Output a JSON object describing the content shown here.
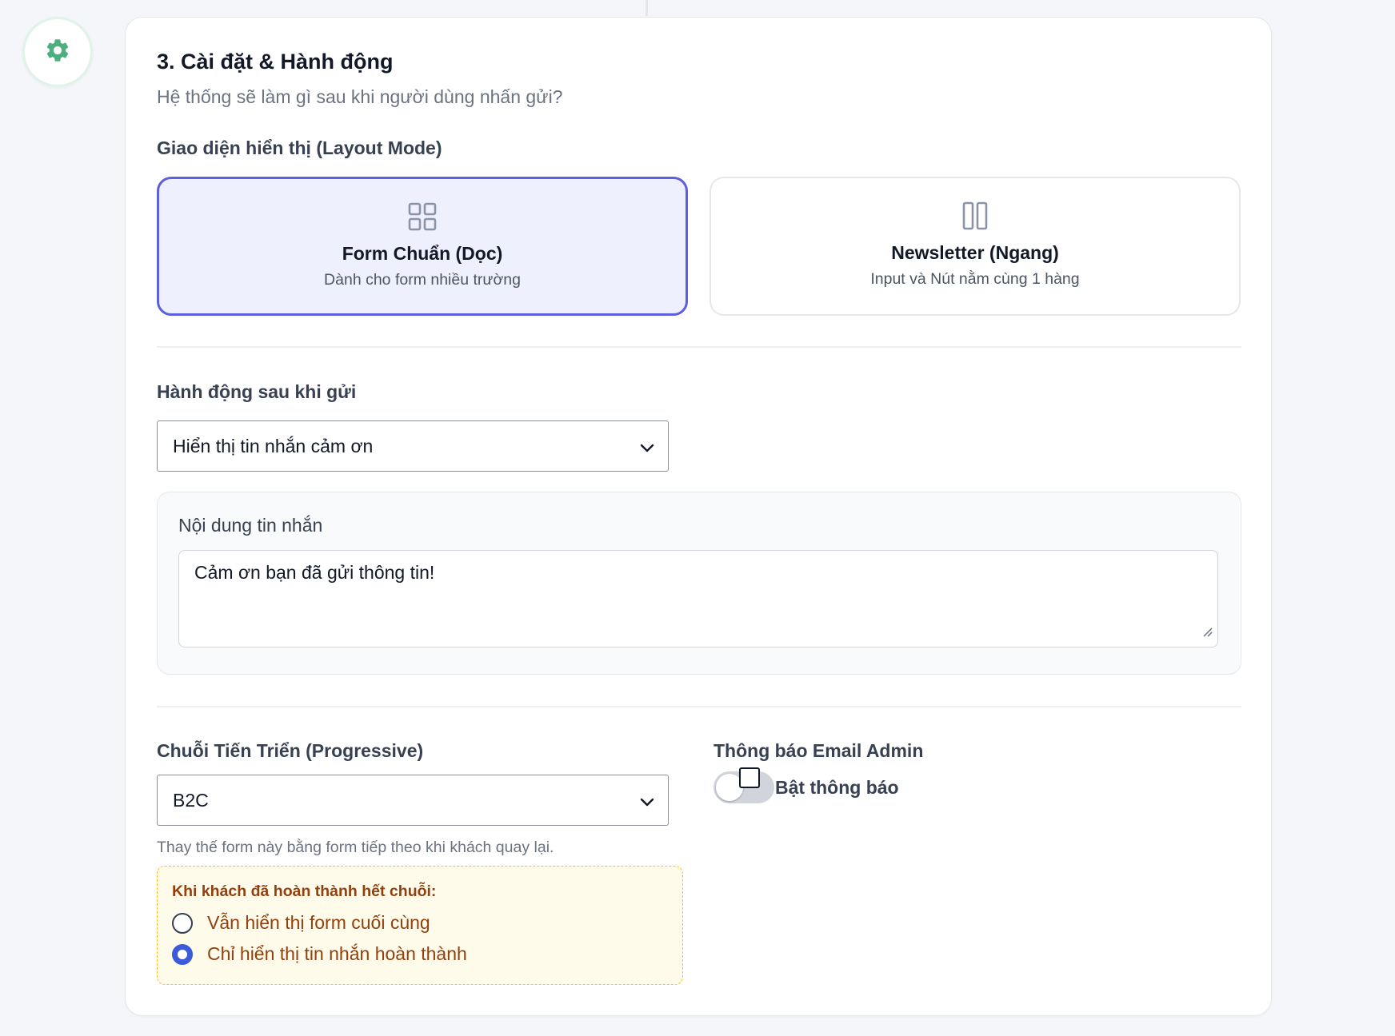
{
  "section": {
    "title": "3. Cài đặt & Hành động",
    "subtitle": "Hệ thống sẽ làm gì sau khi người dùng nhấn gửi?"
  },
  "layout_mode": {
    "label": "Giao diện hiển thị (Layout Mode)",
    "options": [
      {
        "title": "Form Chuẩn (Dọc)",
        "desc": "Dành cho form nhiều trường",
        "icon": "grid-icon",
        "selected": true
      },
      {
        "title": "Newsletter (Ngang)",
        "desc": "Input và Nút nằm cùng 1 hàng",
        "icon": "columns-icon",
        "selected": false
      }
    ]
  },
  "after_submit": {
    "label": "Hành động sau khi gửi",
    "selected": "Hiển thị tin nhắn cảm ơn",
    "message_label": "Nội dung tin nhắn",
    "message_value": "Cảm ơn bạn đã gửi thông tin!"
  },
  "progressive": {
    "label": "Chuỗi Tiến Triển (Progressive)",
    "selected": "B2C",
    "hint": "Thay thế form này bằng form tiếp theo khi khách quay lại.",
    "complete_title": "Khi khách đã hoàn thành hết chuỗi:",
    "options": [
      {
        "label": "Vẫn hiển thị form cuối cùng",
        "checked": false
      },
      {
        "label": "Chỉ hiển thị tin nhắn hoàn thành",
        "checked": true
      }
    ]
  },
  "email_admin": {
    "label": "Thông báo Email Admin",
    "toggle_label": "Bật thông báo",
    "enabled": false
  },
  "colors": {
    "accent": "#5b5fe0",
    "gear": "#4caf7d",
    "radio_checked": "#3b5bdb",
    "warning_text": "#92400e"
  }
}
